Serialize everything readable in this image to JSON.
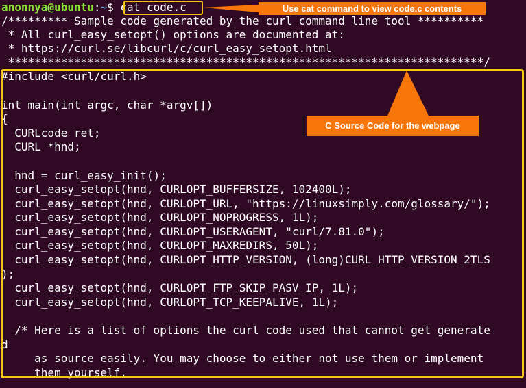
{
  "terminal": {
    "prompt": {
      "user_host": "anonnya@ubuntu",
      "sep": ":",
      "path": "~",
      "symbol": "$ ",
      "command": "cat code.c"
    },
    "lines": [
      "/********* Sample code generated by the curl command line tool **********",
      " * All curl_easy_setopt() options are documented at:",
      " * https://curl.se/libcurl/c/curl_easy_setopt.html",
      " ************************************************************************/",
      "#include <curl/curl.h>",
      "",
      "int main(int argc, char *argv[])",
      "{",
      "  CURLcode ret;",
      "  CURL *hnd;",
      "",
      "  hnd = curl_easy_init();",
      "  curl_easy_setopt(hnd, CURLOPT_BUFFERSIZE, 102400L);",
      "  curl_easy_setopt(hnd, CURLOPT_URL, \"https://linuxsimply.com/glossary/\");",
      "  curl_easy_setopt(hnd, CURLOPT_NOPROGRESS, 1L);",
      "  curl_easy_setopt(hnd, CURLOPT_USERAGENT, \"curl/7.81.0\");",
      "  curl_easy_setopt(hnd, CURLOPT_MAXREDIRS, 50L);",
      "  curl_easy_setopt(hnd, CURLOPT_HTTP_VERSION, (long)CURL_HTTP_VERSION_2TLS",
      ");",
      "  curl_easy_setopt(hnd, CURLOPT_FTP_SKIP_PASV_IP, 1L);",
      "  curl_easy_setopt(hnd, CURLOPT_TCP_KEEPALIVE, 1L);",
      "",
      "  /* Here is a list of options the curl code used that cannot get generate",
      "d",
      "     as source easily. You may choose to either not use them or implement",
      "     them yourself."
    ]
  },
  "annotations": {
    "command_label": "Use cat command to view code.c contents",
    "code_label": "C Source Code for the webpage",
    "color": "#f7760a",
    "box_color": "#f5c518"
  },
  "colors": {
    "background": "#300a24",
    "text": "#ffffff",
    "user_host": "#8ae234",
    "path": "#729fcf"
  }
}
